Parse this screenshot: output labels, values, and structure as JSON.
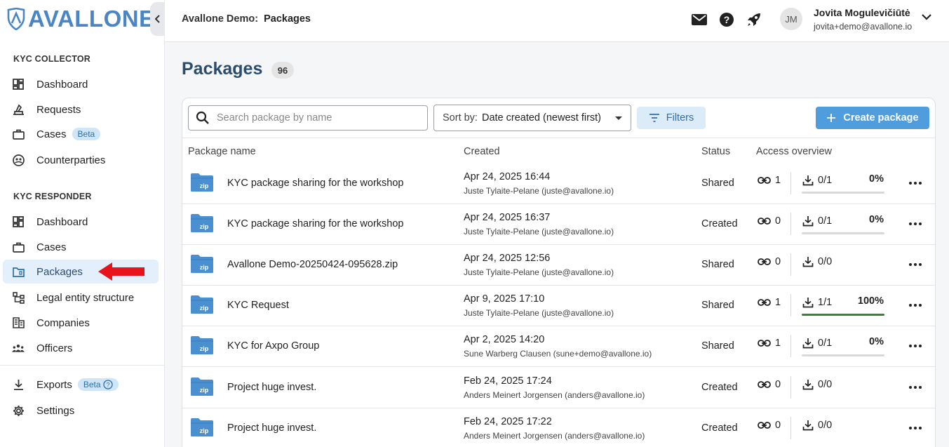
{
  "brand": {
    "logo_text": "AVALLONE",
    "accent": "#4a86c5"
  },
  "sidebar": {
    "sections": [
      {
        "title": "KYC COLLECTOR"
      },
      {
        "title": "KYC RESPONDER"
      }
    ],
    "collector_items": [
      {
        "label": "Dashboard",
        "icon": "dashboard-icon"
      },
      {
        "label": "Requests",
        "icon": "requests-icon"
      },
      {
        "label": "Cases",
        "icon": "briefcase-icon",
        "badge": "Beta"
      },
      {
        "label": "Counterparties",
        "icon": "counterparties-icon"
      }
    ],
    "responder_items": [
      {
        "label": "Dashboard",
        "icon": "dashboard-icon"
      },
      {
        "label": "Cases",
        "icon": "briefcase-icon"
      },
      {
        "label": "Packages",
        "icon": "package-icon",
        "active": true
      },
      {
        "label": "Legal entity structure",
        "icon": "structure-icon"
      },
      {
        "label": "Companies",
        "icon": "companies-icon"
      },
      {
        "label": "Officers",
        "icon": "officers-icon"
      }
    ],
    "bottom_items": [
      {
        "label": "Exports",
        "icon": "download-icon",
        "badge": "Beta"
      },
      {
        "label": "Settings",
        "icon": "gear-icon"
      }
    ]
  },
  "topbar": {
    "breadcrumb_root": "Avallone Demo:",
    "breadcrumb_current": "Packages",
    "user": {
      "initials": "JM",
      "name": "Jovita Mogulevičiūtė",
      "email": "jovita+demo@avallone.io"
    }
  },
  "main": {
    "title": "Packages",
    "count": "96",
    "search_placeholder": "Search package by name",
    "sort_prefix": "Sort by:",
    "sort_value": "Date created (newest first)",
    "filters_label": "Filters",
    "create_label": "Create package",
    "columns": [
      "Package name",
      "Created",
      "Status",
      "Access overview"
    ],
    "zip_label": "zip",
    "rows": [
      {
        "name": "KYC package sharing for the workshop",
        "date": "Apr 24, 2025 16:44",
        "by": "Juste Tylaite-Pelane (juste@avallone.io)",
        "status": "Shared",
        "links": "1",
        "downloads": "0/1",
        "percent": "0%",
        "progress": 0
      },
      {
        "name": "KYC package sharing for the workshop",
        "date": "Apr 24, 2025 16:37",
        "by": "Juste Tylaite-Pelane (juste@avallone.io)",
        "status": "Created",
        "links": "0",
        "downloads": "0/1",
        "percent": "0%",
        "progress": 0
      },
      {
        "name": "Avallone Demo-20250424-095628.zip",
        "date": "Apr 24, 2025 12:56",
        "by": "Juste Tylaite-Pelane (juste@avallone.io)",
        "status": "Shared",
        "links": "0",
        "downloads": "0/0",
        "percent": "",
        "progress": null
      },
      {
        "name": "KYC Request",
        "date": "Apr 9, 2025 17:10",
        "by": "Juste Tylaite-Pelane (juste@avallone.io)",
        "status": "Shared",
        "links": "1",
        "downloads": "1/1",
        "percent": "100%",
        "progress": 1
      },
      {
        "name": "KYC for Axpo Group",
        "date": "Apr 2, 2025 14:20",
        "by": "Sune Warberg Clausen (sune+demo@avallone.io)",
        "status": "Shared",
        "links": "1",
        "downloads": "0/1",
        "percent": "0%",
        "progress": 0
      },
      {
        "name": "Project huge invest.",
        "date": "Feb 24, 2025 17:24",
        "by": "Anders Meinert Jorgensen (anders@avallone.io)",
        "status": "Created",
        "links": "0",
        "downloads": "0/0",
        "percent": "",
        "progress": null
      },
      {
        "name": "Project huge invest.",
        "date": "Feb 24, 2025 17:22",
        "by": "Anders Meinert Jorgensen (anders@avallone.io)",
        "status": "Created",
        "links": "0",
        "downloads": "0/0",
        "percent": "",
        "progress": null
      }
    ]
  },
  "colors": {
    "primary": "#4f9ddd",
    "title": "#2a4d6e",
    "progress_complete": "#3e7d3a",
    "folder": "#4a90d0"
  }
}
